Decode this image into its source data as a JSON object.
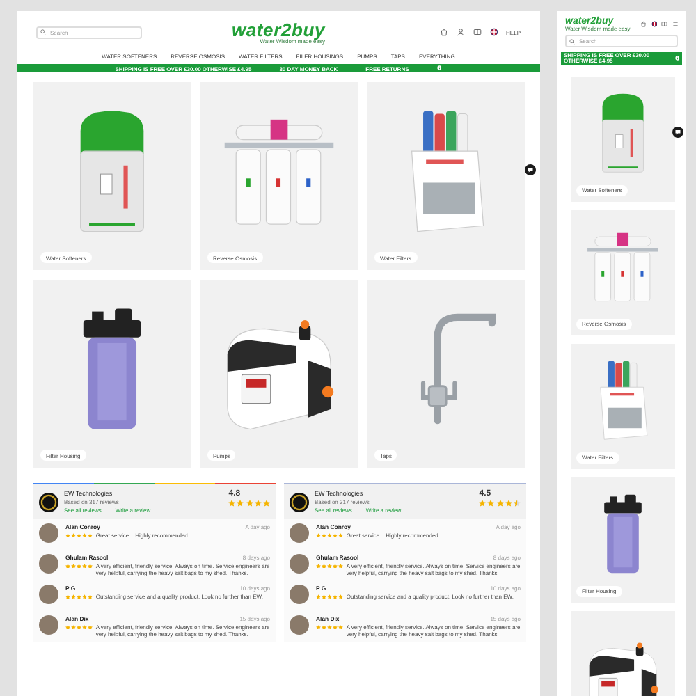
{
  "desktop": {
    "search": {
      "placeholder": "Search"
    },
    "logo": {
      "name": "water2buy",
      "tagline": "Water Wisdom made easy"
    },
    "help": "HELP",
    "nav": [
      "WATER SOFTENERS",
      "REVERSE OSMOSIS",
      "WATER FILTERS",
      "FILER HOUSINGS",
      "PUMPS",
      "TAPS",
      "EVERYTHING"
    ],
    "promo_bar": [
      "SHIPPING IS FREE OVER £30.00 OTHERWISE £4.95",
      "30 DAY MONEY BACK",
      "FREE RETURNS"
    ],
    "categories": [
      {
        "label": "Water Softeners",
        "kind": "softener"
      },
      {
        "label": "Reverse Osmosis",
        "kind": "ro"
      },
      {
        "label": "Water Filters",
        "kind": "filters"
      },
      {
        "label": "Filter Housing",
        "kind": "housing"
      },
      {
        "label": "Pumps",
        "kind": "pump"
      },
      {
        "label": "Taps",
        "kind": "tap"
      }
    ],
    "review_widgets": [
      {
        "company": "EW Technologies",
        "based_on": "Based on 317 reviews",
        "see_all": "See all reviews",
        "write": "Write a review",
        "rating": "4.8",
        "stars": 5,
        "reviews": [
          {
            "name": "Alan Conroy",
            "time": "A day ago",
            "stars": 5,
            "text": "Great service... Highly recommended."
          },
          {
            "name": "Ghulam Rasool",
            "time": "8 days ago",
            "stars": 5,
            "text": "A very efficient, friendly service. Always on time. Service engineers are very helpful, carrying the heavy salt bags to my shed. Thanks."
          },
          {
            "name": "P G",
            "time": "10 days ago",
            "stars": 5,
            "text": "Outstanding service and a quality product. Look no further than EW."
          },
          {
            "name": "Alan Dix",
            "time": "15 days ago",
            "stars": 5,
            "text": "A very efficient, friendly service. Always on time. Service engineers are very helpful, carrying the heavy salt bags to my shed. Thanks."
          }
        ]
      },
      {
        "company": "EW Technologies",
        "based_on": "Based on 317 reviews",
        "see_all": "See all reviews",
        "write": "Write a review",
        "rating": "4.5",
        "stars": 4.5,
        "reviews": [
          {
            "name": "Alan Conroy",
            "time": "A day ago",
            "stars": 5,
            "text": "Great service... Highly recommended."
          },
          {
            "name": "Ghulam Rasool",
            "time": "8 days ago",
            "stars": 5,
            "text": "A very efficient, friendly service. Always on time. Service engineers are very helpful, carrying the heavy salt bags to my shed. Thanks."
          },
          {
            "name": "P G",
            "time": "10 days ago",
            "stars": 5,
            "text": "Outstanding service and a quality product. Look no further than EW."
          },
          {
            "name": "Alan Dix",
            "time": "15 days ago",
            "stars": 5,
            "text": "A very efficient, friendly service. Always on time. Service engineers are very helpful, carrying the heavy salt bags to my shed. Thanks."
          }
        ]
      }
    ]
  },
  "mobile": {
    "logo": {
      "name": "water2buy",
      "tagline": "Water Wisdom made easy"
    },
    "search": {
      "placeholder": "Search"
    },
    "promo_bar": "SHIPPING IS FREE OVER £30.00 OTHERWISE £4.95",
    "categories": [
      {
        "label": "Water Softeners",
        "kind": "softener"
      },
      {
        "label": "Reverse Osmosis",
        "kind": "ro"
      },
      {
        "label": "Water Filters",
        "kind": "filters"
      },
      {
        "label": "Filter Housing",
        "kind": "housing"
      },
      {
        "kind": "pump"
      }
    ]
  }
}
